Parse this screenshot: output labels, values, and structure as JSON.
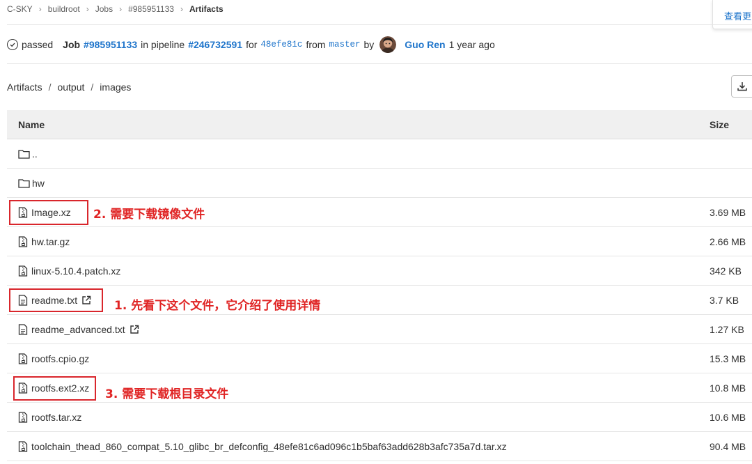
{
  "breadcrumb": [
    "C-SKY",
    "buildroot",
    "Jobs",
    "#985951133",
    "Artifacts"
  ],
  "popover": {
    "link": "查看更"
  },
  "job": {
    "status": "passed",
    "job_label": "Job",
    "job_id": "#985951133",
    "in_pipeline": "in pipeline",
    "pipeline_id": "#246732591",
    "for_text": "for",
    "commit": "48efe81c",
    "from_text": "from",
    "branch": "master",
    "by_text": "by",
    "author": "Guo Ren",
    "time": "1 year ago"
  },
  "path": [
    "Artifacts",
    "output",
    "images"
  ],
  "table": {
    "headers": {
      "name": "Name",
      "size": "Size"
    },
    "rows": [
      {
        "name": "..",
        "type": "folder",
        "size": ""
      },
      {
        "name": "hw",
        "type": "folder",
        "size": ""
      },
      {
        "name": "Image.xz",
        "type": "archive",
        "size": "3.69 MB"
      },
      {
        "name": "hw.tar.gz",
        "type": "archive",
        "size": "2.66 MB"
      },
      {
        "name": "linux-5.10.4.patch.xz",
        "type": "archive",
        "size": "342 KB"
      },
      {
        "name": "readme.txt",
        "type": "text",
        "external": true,
        "size": "3.7 KB"
      },
      {
        "name": "readme_advanced.txt",
        "type": "text",
        "external": true,
        "size": "1.27 KB"
      },
      {
        "name": "rootfs.cpio.gz",
        "type": "archive",
        "size": "15.3 MB"
      },
      {
        "name": "rootfs.ext2.xz",
        "type": "archive",
        "size": "10.8 MB"
      },
      {
        "name": "rootfs.tar.xz",
        "type": "archive",
        "size": "10.6 MB"
      },
      {
        "name": "toolchain_thead_860_compat_5.10_glibc_br_defconfig_48efe81c6ad096c1b5baf63add628b3afc735a7d.tar.xz",
        "type": "archive",
        "size": "90.4 MB"
      }
    ]
  },
  "annotations": {
    "image": "2. 需要下载镜像文件",
    "readme": "1. 先看下这个文件，它介绍了使用详情",
    "rootfs": "3. 需要下载根目录文件",
    "color": "#e02424"
  },
  "colors": {
    "link": "#1f75cb",
    "header_bg": "#f0f0f0",
    "annotation": "#d9262c"
  }
}
